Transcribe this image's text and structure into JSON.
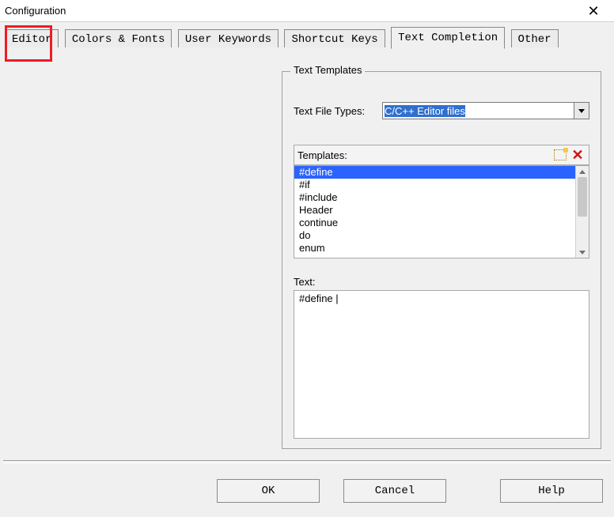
{
  "window": {
    "title": "Configuration",
    "close_glyph": "✕"
  },
  "tabs": [
    {
      "label": "Editor",
      "active": false
    },
    {
      "label": "Colors & Fonts",
      "active": false
    },
    {
      "label": "User Keywords",
      "active": false
    },
    {
      "label": "Shortcut Keys",
      "active": false
    },
    {
      "label": "Text Completion",
      "active": true
    },
    {
      "label": "Other",
      "active": false
    }
  ],
  "group": {
    "legend": "Text Templates",
    "file_types_label": "Text File Types:",
    "file_types_value": "C/C++ Editor files",
    "templates_label": "Templates:",
    "templates_items": [
      {
        "label": "#define",
        "selected": true
      },
      {
        "label": "#if",
        "selected": false
      },
      {
        "label": "#include",
        "selected": false
      },
      {
        "label": "Header",
        "selected": false
      },
      {
        "label": "continue",
        "selected": false
      },
      {
        "label": "do",
        "selected": false
      },
      {
        "label": "enum",
        "selected": false
      }
    ],
    "text_label": "Text:",
    "text_value": "#define |"
  },
  "icons": {
    "new_template": "new-template-icon",
    "delete_template": "delete-icon"
  },
  "buttons": {
    "ok": "OK",
    "cancel": "Cancel",
    "help": "Help"
  }
}
